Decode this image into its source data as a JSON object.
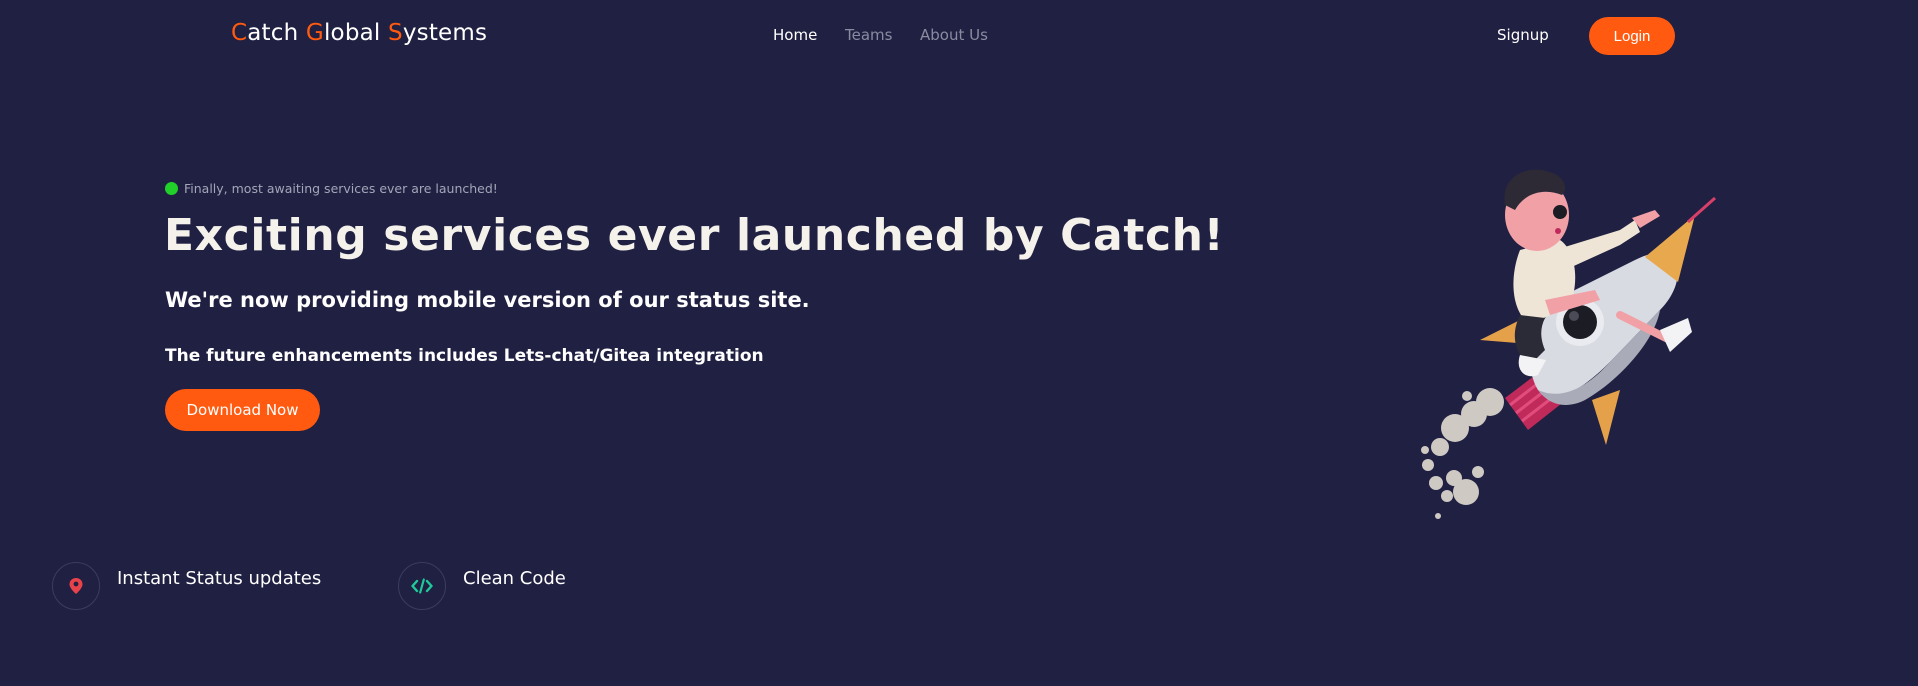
{
  "nav": {
    "brand": [
      {
        "text": "C",
        "accent": true
      },
      {
        "text": "atch ",
        "accent": false
      },
      {
        "text": "G",
        "accent": true
      },
      {
        "text": "lobal ",
        "accent": false
      },
      {
        "text": "S",
        "accent": true
      },
      {
        "text": "ystems",
        "accent": false
      }
    ],
    "links": {
      "home": "Home",
      "teams": "Teams",
      "about": "About Us"
    },
    "active": "Home",
    "signup": "Signup",
    "login": "Login"
  },
  "hero": {
    "badge": "Finally, most awaiting services ever are launched!",
    "title": "Exciting services ever launched by Catch!",
    "subtitle": "We're now providing mobile version of our status site.",
    "subtitle2": "The future enhancements includes Lets-chat/Gitea integration",
    "cta": "Download Now",
    "illustration": "boy-riding-rocket"
  },
  "features": [
    {
      "label": "Instant Status updates",
      "icon": "map-pin-icon"
    },
    {
      "label": "Clean Code",
      "icon": "code-icon"
    }
  ],
  "colors": {
    "background": "#202042",
    "accent": "#ff5a10",
    "status_dot": "#21d12a",
    "pin_icon": "#e8424a",
    "code_icon": "#1fc99a",
    "muted_text": "#8a8ba0"
  }
}
